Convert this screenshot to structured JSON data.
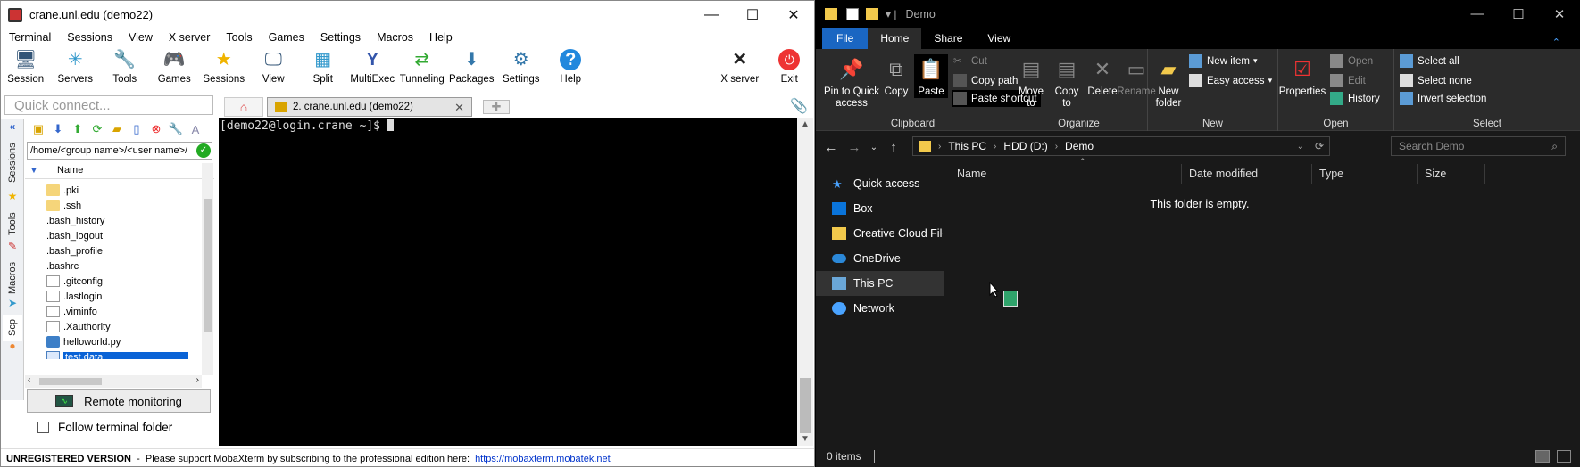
{
  "moba": {
    "title": "crane.unl.edu (demo22)",
    "menu": [
      "Terminal",
      "Sessions",
      "View",
      "X server",
      "Tools",
      "Games",
      "Settings",
      "Macros",
      "Help"
    ],
    "toolbar": [
      {
        "label": "Session",
        "icon": "session-icon",
        "glyph": "🖥"
      },
      {
        "label": "Servers",
        "icon": "servers-icon",
        "glyph": "✳"
      },
      {
        "label": "Tools",
        "icon": "tools-icon",
        "glyph": "🔧"
      },
      {
        "label": "Games",
        "icon": "games-icon",
        "glyph": "🎮"
      },
      {
        "label": "Sessions",
        "icon": "star-icon",
        "glyph": "★"
      },
      {
        "label": "View",
        "icon": "view-icon",
        "glyph": "🖵"
      },
      {
        "label": "Split",
        "icon": "split-icon",
        "glyph": "▦"
      },
      {
        "label": "MultiExec",
        "icon": "multiexec-icon",
        "glyph": "Y"
      },
      {
        "label": "Tunneling",
        "icon": "tunneling-icon",
        "glyph": "⇄"
      },
      {
        "label": "Packages",
        "icon": "packages-icon",
        "glyph": "⬇"
      },
      {
        "label": "Settings",
        "icon": "settings-icon",
        "glyph": "⚙"
      },
      {
        "label": "Help",
        "icon": "help-icon",
        "glyph": "?"
      }
    ],
    "xserver_label": "X server",
    "exit_label": "Exit",
    "quick_connect_placeholder": "Quick connect...",
    "tab_label": "2. crane.unl.edu (demo22)",
    "side_tabs": [
      "Sessions",
      "Tools",
      "Macros",
      "Scp"
    ],
    "scp_path": "/home/<group name>/<user name>/",
    "scp_col_name": "Name",
    "files": [
      {
        "name": ".pki",
        "type": "folder"
      },
      {
        "name": ".ssh",
        "type": "folder"
      },
      {
        "name": ".bash_history",
        "type": "term"
      },
      {
        "name": ".bash_logout",
        "type": "term"
      },
      {
        "name": ".bash_profile",
        "type": "term"
      },
      {
        "name": ".bashrc",
        "type": "term"
      },
      {
        "name": ".gitconfig",
        "type": "doc"
      },
      {
        "name": ".lastlogin",
        "type": "doc"
      },
      {
        "name": ".viminfo",
        "type": "doc"
      },
      {
        "name": ".Xauthority",
        "type": "doc"
      },
      {
        "name": "helloworld.py",
        "type": "py"
      },
      {
        "name": "test.data",
        "type": "sel"
      }
    ],
    "remote_monitoring": "Remote monitoring",
    "follow_folder": "Follow terminal folder",
    "prompt": "[demo22@login.crane ~]$ ",
    "status_bold": "UNREGISTERED VERSION",
    "status_text": "  -  Please support MobaXterm by subscribing to the professional edition here:",
    "status_link": "https://mobaxterm.mobatek.net"
  },
  "explorer": {
    "title": "Demo",
    "tabs": [
      "File",
      "Home",
      "Share",
      "View"
    ],
    "ribbon": {
      "pin": "Pin to Quick access",
      "copy": "Copy",
      "paste": "Paste",
      "cut": "Cut",
      "copy_path": "Copy path",
      "paste_shortcut": "Paste shortcut",
      "clipboard": "Clipboard",
      "move_to": "Move to",
      "copy_to": "Copy to",
      "delete": "Delete",
      "rename": "Rename",
      "organize": "Organize",
      "new_folder": "New folder",
      "new_item": "New item",
      "easy_access": "Easy access",
      "new": "New",
      "properties": "Properties",
      "open": "Open",
      "edit": "Edit",
      "history": "History",
      "open_group": "Open",
      "select_all": "Select all",
      "select_none": "Select none",
      "invert_selection": "Invert selection",
      "select": "Select"
    },
    "breadcrumb": [
      "This PC",
      "HDD (D:)",
      "Demo"
    ],
    "search_placeholder": "Search Demo",
    "nav": [
      "Quick access",
      "Box",
      "Creative Cloud Files",
      "OneDrive",
      "This PC",
      "Network"
    ],
    "columns": [
      "Name",
      "Date modified",
      "Type",
      "Size"
    ],
    "empty_text": "This folder is empty.",
    "status": "0 items"
  }
}
